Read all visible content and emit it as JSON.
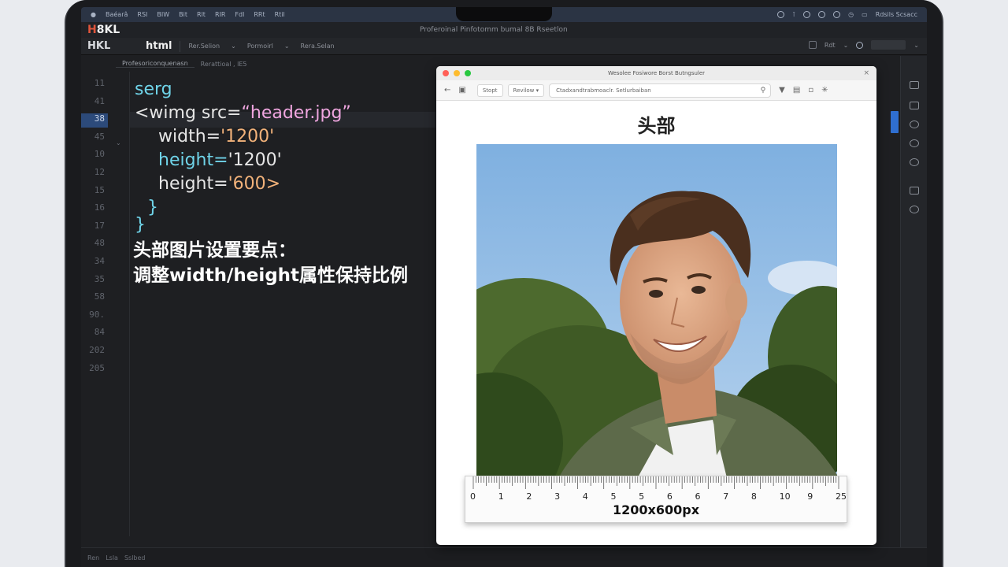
{
  "menubar": {
    "items": [
      "Baéarâ",
      "RSI",
      "BIW",
      "Bit",
      "Rlt",
      "RIR",
      "Fdl",
      "RRt",
      "Rtil"
    ],
    "right_label": "Rdsils Scsacc"
  },
  "window": {
    "brand": "8KL",
    "title": "Proferoinal Pinfotomm bumal 8B Rseetlon"
  },
  "toolbar": {
    "logo": "HKL",
    "file_label": "html",
    "items": [
      "Rer.Selion",
      "Pormoirl",
      "Rera.Selan"
    ],
    "right_item": "Rdt"
  },
  "tabs": [
    "Profesoriconquenasn",
    "Rerattioal , lE5"
  ],
  "gutter": {
    "line_numbers": [
      "11",
      "41",
      "38",
      "45",
      "10",
      "12",
      "15",
      "16",
      "17",
      "48",
      "34",
      "35",
      "58",
      "90.",
      "84",
      "202",
      "205"
    ],
    "current_index": 2
  },
  "code": {
    "line1": "serg",
    "line2_prefix": "<wimg src=",
    "line2_value": "“header.jpg”",
    "line3_attr": "width=",
    "line3_value": "'1200'",
    "line4_attr": "height=",
    "line4_value": "'1200'",
    "line5_attr": "height=",
    "line5_value": "'600>",
    "line6": "}",
    "line7": "}",
    "note1": "头部图片设置要点：",
    "note2": "调整width/height属性保持比例"
  },
  "statusbar": [
    "Ren",
    "Lsla",
    "Sslbed"
  ],
  "browser": {
    "title": "Wesolee Fosiwore Borst Butngsuler",
    "back_btn": "Stopt",
    "view_btn": "Revilow",
    "url": "Ctadxandtrabmoaclr. Setlurbaiban",
    "heading": "头部",
    "photo_alt": "header photo: smiling young man outdoors",
    "ruler_numbers": [
      "0",
      "1",
      "2",
      "3",
      "4",
      "5",
      "5",
      "6",
      "6",
      "7",
      "8",
      "10",
      "9",
      "25"
    ],
    "ruler_label": "1200x600px"
  },
  "colors": {
    "accent": "#2f6fd1",
    "code_tag": "#6fd3e8",
    "code_string": "#f0a6e0",
    "code_number": "#f2b27a"
  }
}
